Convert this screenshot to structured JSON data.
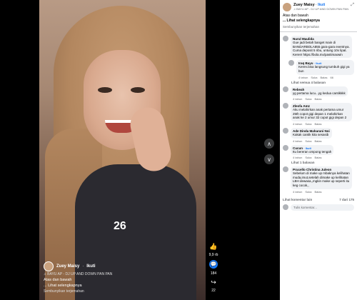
{
  "video": {
    "number": "26",
    "overlay": {
      "name": "Zuey Maisy",
      "follow": "Ikuti",
      "audio": "BAYU AP - DJ UP AND DOWN PAN PAN",
      "caption": "Atas dan bawah",
      "more": "... Lihat selengkapnya",
      "translation": "Sembunyikan terjemahan"
    },
    "side": {
      "likes": "9,9 rb",
      "comments": "184",
      "shares": "22"
    }
  },
  "panel": {
    "name": "Zuey Maisy",
    "follow": "Ikuti",
    "audio": "BAYU AP - DJ UP AND DOWN PAN PAN",
    "caption": "Atas dan bawah",
    "more": "... Lihat selengkapnya",
    "hide_translation": "Sembunyikan terjemahan",
    "comments": [
      {
        "name": "Nurul Maulida",
        "text": "Gue jadi betah banget main di BANDARBOLA855 gara-gara eventnya. Cuma deposit 5 ribu, untung 10x lipat. Keren! https://bola.mx/pastimaxwin",
        "reply": false,
        "time": "",
        "count": ""
      },
      {
        "name": "Iraq Bayu",
        "text": "Keren.bisa langsung tumbuh gigi ya bun",
        "reply": true,
        "time": "4 tahun",
        "count": "66"
      },
      {
        "name": "Rebeah",
        "text": "yg pertama lucu...yg kedua cantikkkk",
        "reply": false,
        "time": "4 tahun",
        "count": ""
      },
      {
        "name": "Zleofa Amz",
        "text": "Aku melahirkan anak pertama umur 25th copot gigi depan 1 melahirkan anak ke 2 umur 32 copot gigi depan 2",
        "reply": false,
        "time": "4 tahun",
        "count": ""
      },
      {
        "name": "Ade Dinda Maharani Noi",
        "text": "Kakak cantik kita sesasib",
        "reply": false,
        "time": "4 tahun",
        "count": ""
      },
      {
        "name": "Cucun",
        "text": "Itu bereran ompong tengah",
        "reply": false,
        "time": "4 tahun",
        "count": ""
      },
      {
        "name": "Prucello Christina Juleon",
        "text": "Sebelum di make up mbaknya kelihatan muda,imut,setelah dimake up kelihatan LBH dewasa,,mgkin make up seperti itu keg cocok,,",
        "reply": false,
        "time": "4 tahun",
        "count": ""
      }
    ],
    "see_replies": "Lihat semua 4 balasan",
    "see_reply": "Lihat 1 balasan",
    "other_comments": "Lihat komentar lain",
    "comments_count": "7 dari 175",
    "input_placeholder": "Tulis komentar...",
    "actions": {
      "like": "Suka",
      "reply": "Balas"
    }
  }
}
